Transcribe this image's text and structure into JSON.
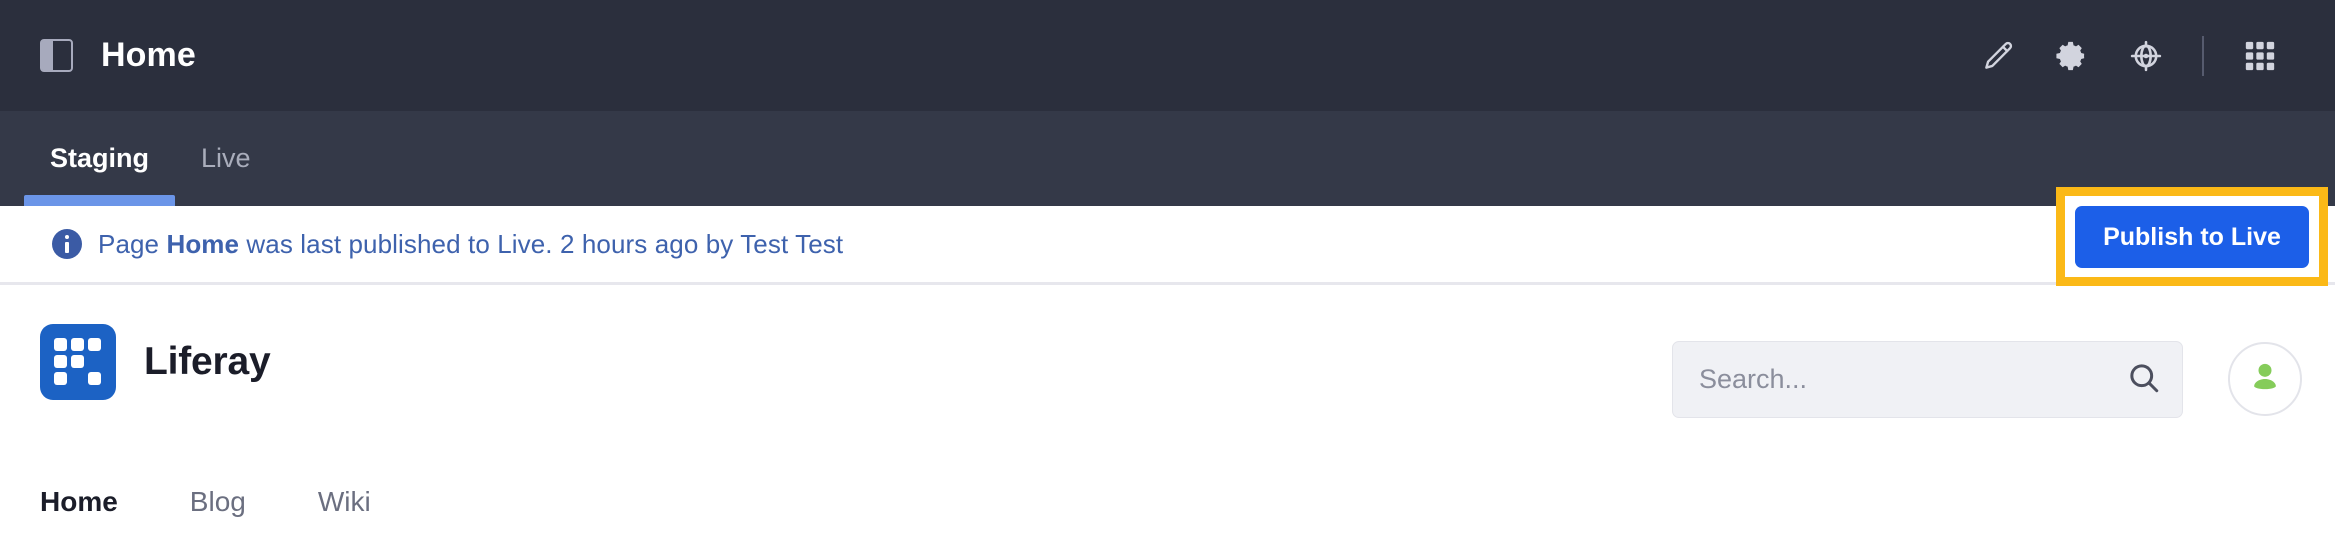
{
  "product_bar": {
    "panel_toggle_icon": "sidebar-panel-icon",
    "title": "Home",
    "actions": [
      {
        "id": "edit",
        "icon": "pencil-icon",
        "label": "Edit"
      },
      {
        "id": "settings",
        "icon": "gear-icon",
        "label": "Settings"
      },
      {
        "id": "simulation",
        "icon": "target-globe-icon",
        "label": "Simulation"
      },
      {
        "id": "applications",
        "icon": "grid-apps-icon",
        "label": "Applications Menu"
      }
    ]
  },
  "staging": {
    "tabs": [
      {
        "label": "Staging",
        "active": true
      },
      {
        "label": "Live",
        "active": false
      }
    ]
  },
  "alert": {
    "icon": "info-circle-icon",
    "prefix": "Page ",
    "page_name": "Home",
    "suffix": " was last published to Live. 2 hours ago by Test Test",
    "publish_button": "Publish to Live",
    "highlight_color": "#fbb917",
    "button_color": "#1c5fe8",
    "text_color": "#3e62ad"
  },
  "site_header": {
    "logo_icon": "liferay-logo-icon",
    "logo_color": "#1c62c4",
    "brand_name": "Liferay",
    "search": {
      "value": "",
      "placeholder": "Search...",
      "icon": "search-icon"
    },
    "avatar": {
      "icon": "user-avatar-icon",
      "color": "#85cc5a"
    }
  },
  "site_nav": {
    "items": [
      {
        "label": "Home",
        "active": true
      },
      {
        "label": "Blog",
        "active": false
      },
      {
        "label": "Wiki",
        "active": false
      }
    ]
  }
}
